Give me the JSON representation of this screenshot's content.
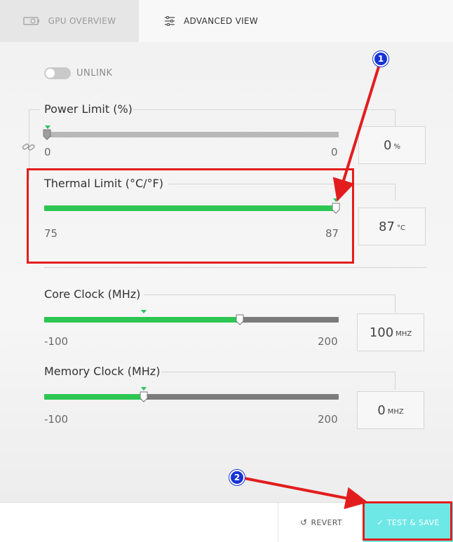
{
  "tabs": {
    "gpu_overview": "GPU OVERVIEW",
    "advanced_view": "ADVANCED VIEW"
  },
  "unlink": {
    "label": "UNLINK"
  },
  "sliders": [
    {
      "title": "Power Limit (%)",
      "min": "0",
      "max": "0",
      "value": "0",
      "unit": "%",
      "fill_fraction": 0,
      "marker_fraction": 0,
      "color": "#b8b8b8"
    },
    {
      "title": "Thermal Limit (°C/°F)",
      "min": "75",
      "max": "87",
      "value": "87",
      "unit": "°C",
      "fill_fraction": 1,
      "marker_fraction": 1,
      "color": "#2dc653"
    },
    {
      "title": "Core Clock (MHz)",
      "min": "-100",
      "max": "200",
      "value": "100",
      "unit": "MHZ",
      "fill_fraction": 0.667,
      "marker_fraction": 0.333,
      "color": "#2dc653"
    },
    {
      "title": "Memory Clock (MHz)",
      "min": "-100",
      "max": "200",
      "value": "0",
      "unit": "MHZ",
      "fill_fraction": 0.333,
      "marker_fraction": 0.333,
      "color": "#2dc653"
    }
  ],
  "footer": {
    "revert": "REVERT",
    "test_save": "TEST & SAVE"
  },
  "annotations": {
    "badge1": "1",
    "badge2": "2"
  },
  "colors": {
    "accent_green": "#2dc653",
    "save_cyan": "#6ee8e6",
    "highlight_red": "#e31d1d",
    "badge_blue": "#1733d6"
  }
}
